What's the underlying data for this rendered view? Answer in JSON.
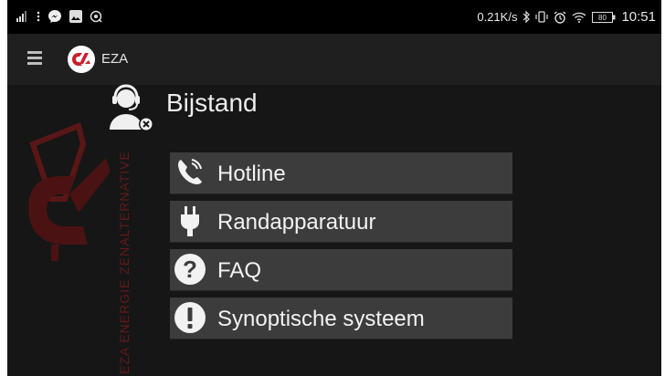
{
  "status_bar": {
    "network_speed": "0.21K/s",
    "battery": "80",
    "time": "10:51",
    "icons": [
      "signal-icon",
      "more-icon",
      "messenger-icon",
      "gallery-icon",
      "cast-icon",
      "bluetooth-icon",
      "vibrate-icon",
      "alarm-icon",
      "wifi-icon",
      "battery-icon"
    ]
  },
  "toolbar": {
    "app_name": "EZA",
    "icons": [
      "hamburger-menu-icon",
      "eza-logo"
    ]
  },
  "header": {
    "title": "Bijstand",
    "icon": "support-headset-icon"
  },
  "menu": [
    {
      "label": "Hotline",
      "icon": "phone-icon"
    },
    {
      "label": "Randapparatuur",
      "icon": "plug-icon"
    },
    {
      "label": "FAQ",
      "icon": "question-icon"
    },
    {
      "label": "Synoptische systeem",
      "icon": "exclamation-icon"
    }
  ],
  "watermark_text": "EZA ENERGIE ZENALTERNATIVE",
  "colors": {
    "background": "#161616",
    "toolbar": "#1f1f1f",
    "menu_item": "#3c3c3c",
    "brand_red": "#c8202a"
  }
}
